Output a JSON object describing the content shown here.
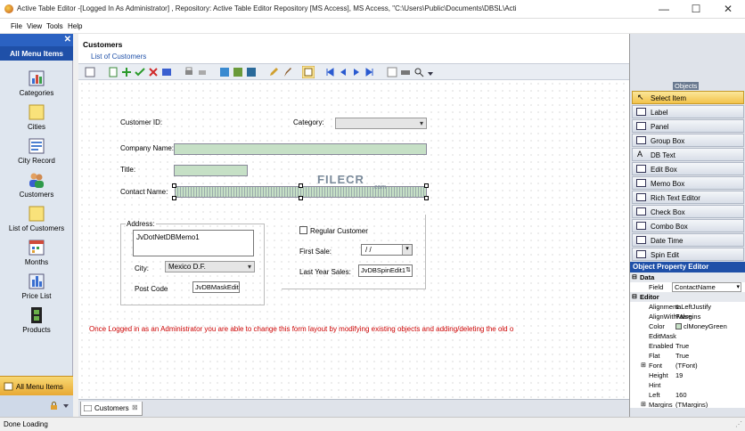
{
  "window": {
    "title": "Active Table Editor -[Logged In As Administrator] , Repository: Active Table Editor Repository  [MS Access], MS Access, \"C:\\Users\\Public\\Documents\\DBSL\\Activ...",
    "minimize": "—",
    "maximize": "☐",
    "close": "✕"
  },
  "menu": {
    "file": "File",
    "view": "View",
    "tools": "Tools",
    "help": "Help"
  },
  "sidebar": {
    "header": "All Menu Items",
    "close": "✕",
    "items": [
      {
        "label": "Categories",
        "icon": "bar-chart-icon"
      },
      {
        "label": "Cities",
        "icon": "folder-icon"
      },
      {
        "label": "City Record",
        "icon": "form-icon"
      },
      {
        "label": "Customers",
        "icon": "users-icon"
      },
      {
        "label": "List of Customers",
        "icon": "folder-icon"
      },
      {
        "label": "Months",
        "icon": "calendar-icon"
      },
      {
        "label": "Price List",
        "icon": "bar-chart-icon"
      },
      {
        "label": "Products",
        "icon": "film-icon"
      }
    ],
    "bottom_label": "All Menu Items"
  },
  "main": {
    "title": "Customers",
    "subtitle": "List of Customers",
    "tab": "Customers"
  },
  "form": {
    "customer_id_label": "Customer ID:",
    "category_label": "Category:",
    "company_name_label": "Company Name:",
    "title_label": "Title:",
    "contact_name_label": "Contact Name:",
    "address_label": "Address:",
    "memo_value": "JvDotNetDBMemo1",
    "city_label": "City:",
    "city_value": "Mexico D.F.",
    "post_code_label": "Post Code",
    "post_code_value": "JvDBMaskEdit",
    "regular_customer_label": "Regular Customer",
    "first_sale_label": "First Sale:",
    "first_sale_value": " / /",
    "last_year_sales_label": "Last Year Sales:",
    "last_year_sales_value": "JvDBSpinEdit1",
    "watermark": "FILECR",
    "watermark_sub": ".com",
    "admin_note": "Once Logged in as an Administrator you are able to change this form layout by modifying existing objects and adding/deleting the old o"
  },
  "objects": {
    "title": "Objects",
    "items": [
      "Select Item",
      "Label",
      "Panel",
      "Group Box",
      "DB Text",
      "Edit Box",
      "Memo Box",
      "Rich Text Editor",
      "Check Box",
      "Combo Box",
      "Date Time",
      "Spin Edit"
    ]
  },
  "properties": {
    "title": "Object Property Editor",
    "data_section": "Data",
    "field_key": "Field",
    "field_value": "ContactName",
    "editor_section": "Editor",
    "rows": [
      {
        "k": "Alignment",
        "v": "taLeftJustify"
      },
      {
        "k": "AlignWithMargins",
        "v": "False"
      },
      {
        "k": "Color",
        "v": "clMoneyGreen"
      },
      {
        "k": "EditMask",
        "v": ""
      },
      {
        "k": "Enabled",
        "v": "True"
      },
      {
        "k": "Flat",
        "v": "True"
      },
      {
        "k": "Font",
        "v": "(TFont)"
      },
      {
        "k": "Height",
        "v": "19"
      },
      {
        "k": "Hint",
        "v": ""
      },
      {
        "k": "Left",
        "v": "160"
      },
      {
        "k": "Margins",
        "v": "(TMargins)"
      }
    ]
  },
  "status": {
    "text": "Done Loading"
  },
  "colors": {
    "accent": "#1f50a8",
    "field_green": "#c6e0c6",
    "note_red": "#cc0000"
  }
}
